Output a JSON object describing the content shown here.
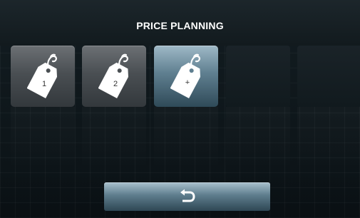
{
  "header": {
    "title": "PRICE PLANNING"
  },
  "tiles": [
    {
      "type": "price",
      "label": "1",
      "icon": "price-tag-icon"
    },
    {
      "type": "price",
      "label": "2",
      "icon": "price-tag-icon"
    },
    {
      "type": "add",
      "label": "+",
      "icon": "price-tag-icon"
    },
    {
      "type": "empty"
    },
    {
      "type": "empty"
    }
  ],
  "footer": {
    "back_icon": "return-arrow-icon"
  },
  "colors": {
    "background": "#0e161a",
    "tile_gray": "#4a4f53",
    "tile_accent": "#5f7f90",
    "text": "#ffffff"
  }
}
